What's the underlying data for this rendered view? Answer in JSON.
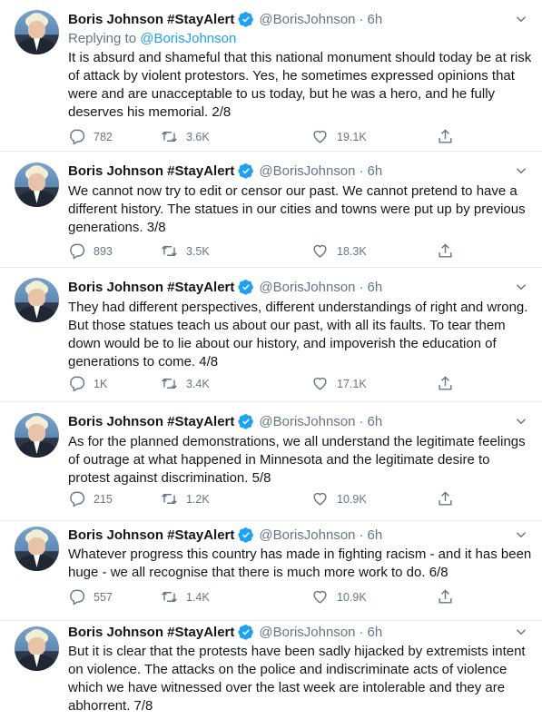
{
  "account": {
    "name": "Boris Johnson #StayAlert",
    "handle": "@BorisJohnson",
    "separator": "·",
    "time": "6h"
  },
  "colors": {
    "accent": "#1da1f2",
    "secondary_text": "#657786",
    "primary_text": "#14171a",
    "divider": "#e6ecf0"
  },
  "icons": [
    "verified-badge-icon",
    "chevron-down-icon",
    "reply-icon",
    "retweet-icon",
    "like-icon",
    "share-icon"
  ],
  "tweets": [
    {
      "replying_prefix": "Replying to ",
      "replying_to": "@BorisJohnson",
      "text": "It is absurd and shameful that this national monument should today be at risk of attack by violent protestors. Yes, he sometimes expressed opinions that were and are unacceptable to us today, but he was a hero, and he fully deserves his memorial. 2/8",
      "replies": "782",
      "retweets": "3.6K",
      "likes": "19.1K"
    },
    {
      "text": "We cannot now try to edit or censor our past. We cannot pretend to have a different history. The statues in our cities and towns were put up by previous generations. 3/8",
      "replies": "893",
      "retweets": "3.5K",
      "likes": "18.3K"
    },
    {
      "text": "They had different perspectives, different understandings of right and wrong. But those statues teach us about our past, with all its faults. To tear them down would be to lie about our history, and impoverish the education of generations to come. 4/8",
      "replies": "1K",
      "retweets": "3.4K",
      "likes": "17.1K"
    },
    {
      "text": "As for the planned demonstrations, we all understand the legitimate feelings of outrage at what happened in Minnesota and the legitimate desire to protest against discrimination. 5/8",
      "replies": "215",
      "retweets": "1.2K",
      "likes": "10.9K"
    },
    {
      "text": "Whatever progress this country has made in fighting racism - and it has been huge - we all recognise that there is much more work to do. 6/8",
      "replies": "557",
      "retweets": "1.4K",
      "likes": "10.9K"
    },
    {
      "text": "But it is clear that the protests have been sadly hijacked by extremists intent on violence. The attacks on the police and indiscriminate acts of violence which we have witnessed over the last week are intolerable and they are abhorrent. 7/8"
    }
  ]
}
